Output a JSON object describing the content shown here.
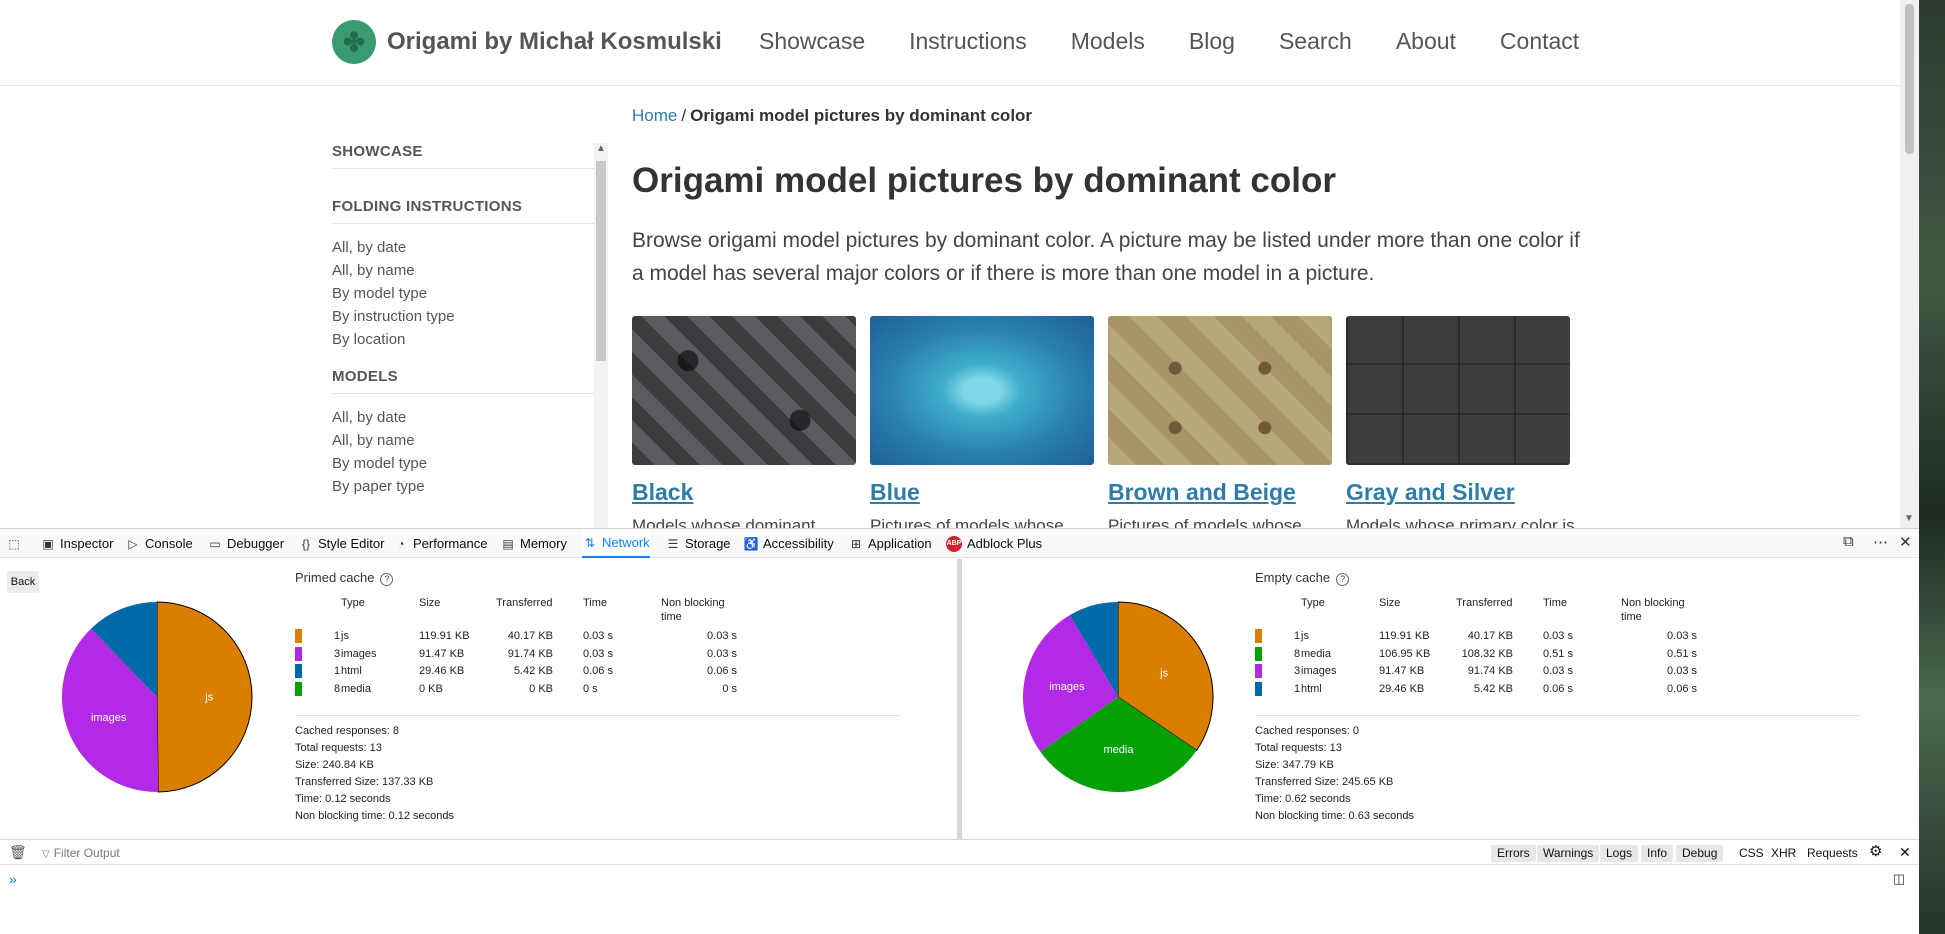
{
  "site": {
    "title": "Origami by Michał Kosmulski",
    "nav": [
      "Showcase",
      "Instructions",
      "Models",
      "Blog",
      "Search",
      "About",
      "Contact"
    ],
    "breadcrumb": {
      "home": "Home",
      "separator": "/",
      "current": "Origami model pictures by dominant color"
    },
    "sidebar": {
      "sections": [
        {
          "heading": "SHOWCASE",
          "items": []
        },
        {
          "heading": "FOLDING INSTRUCTIONS",
          "items": [
            "All, by date",
            "All, by name",
            "By model type",
            "By instruction type",
            "By location"
          ]
        },
        {
          "heading": "MODELS",
          "items": [
            "All, by date",
            "All, by name",
            "By model type",
            "By paper type"
          ]
        }
      ]
    },
    "page_title": "Origami model pictures by dominant color",
    "intro": "Browse origami model pictures by dominant color. A picture may be listed under more than one color if a model has several major colors or if there is more than one model in a picture.",
    "tiles": [
      {
        "name": "Black",
        "desc": "Models whose dominant"
      },
      {
        "name": "Blue",
        "desc": "Pictures of models whose"
      },
      {
        "name": "Brown and Beige",
        "desc": "Pictures of models whose"
      },
      {
        "name": "Gray and Silver",
        "desc": "Models whose primary color is"
      }
    ]
  },
  "devtools": {
    "tabs": [
      "Inspector",
      "Console",
      "Debugger",
      "Style Editor",
      "Performance",
      "Memory",
      "Network",
      "Storage",
      "Accessibility",
      "Application",
      "Adblock Plus"
    ],
    "active_tab": "Network",
    "back_label": "Back",
    "columns": [
      "Type",
      "Size",
      "Transferred",
      "Time",
      "Non blocking time"
    ],
    "primed": {
      "title": "Primed cache",
      "rows": [
        {
          "count": "1",
          "type": "js",
          "size": "119.91 KB",
          "transferred": "40.17 KB",
          "time": "0.03 s",
          "nonblocking": "0.03 s",
          "color": "#d97e00"
        },
        {
          "count": "3",
          "type": "images",
          "size": "91.47 KB",
          "transferred": "91.74 KB",
          "time": "0.03 s",
          "nonblocking": "0.03 s",
          "color": "#b22ae5"
        },
        {
          "count": "1",
          "type": "html",
          "size": "29.46 KB",
          "transferred": "5.42 KB",
          "time": "0.06 s",
          "nonblocking": "0.06 s",
          "color": "#0069a8"
        },
        {
          "count": "8",
          "type": "media",
          "size": "0 KB",
          "transferred": "0 KB",
          "time": "0 s",
          "nonblocking": "0 s",
          "color": "#05a005"
        }
      ],
      "summary": [
        "Cached responses: 8",
        "Total requests: 13",
        "Size: 240.84 KB",
        "Transferred Size: 137.33 KB",
        "Time: 0.12 seconds",
        "Non blocking time: 0.12 seconds"
      ]
    },
    "empty": {
      "title": "Empty cache",
      "rows": [
        {
          "count": "1",
          "type": "js",
          "size": "119.91 KB",
          "transferred": "40.17 KB",
          "time": "0.03 s",
          "nonblocking": "0.03 s",
          "color": "#d97e00"
        },
        {
          "count": "8",
          "type": "media",
          "size": "106.95 KB",
          "transferred": "108.32 KB",
          "time": "0.51 s",
          "nonblocking": "0.51 s",
          "color": "#05a005"
        },
        {
          "count": "3",
          "type": "images",
          "size": "91.47 KB",
          "transferred": "91.74 KB",
          "time": "0.03 s",
          "nonblocking": "0.03 s",
          "color": "#b22ae5"
        },
        {
          "count": "1",
          "type": "html",
          "size": "29.46 KB",
          "transferred": "5.42 KB",
          "time": "0.06 s",
          "nonblocking": "0.06 s",
          "color": "#0069a8"
        }
      ],
      "summary": [
        "Cached responses: 0",
        "Total requests: 13",
        "Size: 347.79 KB",
        "Transferred Size: 245.65 KB",
        "Time: 0.62 seconds",
        "Non blocking time: 0.63 seconds"
      ]
    },
    "console": {
      "filter_placeholder": "Filter Output",
      "levels": [
        "Errors",
        "Warnings",
        "Logs",
        "Info",
        "Debug"
      ],
      "extras": [
        "CSS",
        "XHR",
        "Requests"
      ],
      "prompt": "»"
    }
  },
  "chart_data": [
    {
      "type": "pie",
      "title": "Primed cache",
      "slices": [
        {
          "name": "js",
          "value": 119.91,
          "color": "#d97e00"
        },
        {
          "name": "images",
          "value": 91.47,
          "color": "#b22ae5"
        },
        {
          "name": "html",
          "value": 29.46,
          "color": "#0069a8"
        },
        {
          "name": "media",
          "value": 0,
          "color": "#05a005"
        }
      ]
    },
    {
      "type": "pie",
      "title": "Empty cache",
      "slices": [
        {
          "name": "js",
          "value": 119.91,
          "color": "#d97e00"
        },
        {
          "name": "media",
          "value": 106.95,
          "color": "#05a005"
        },
        {
          "name": "images",
          "value": 91.47,
          "color": "#b22ae5"
        },
        {
          "name": "html",
          "value": 29.46,
          "color": "#0069a8"
        }
      ]
    }
  ]
}
